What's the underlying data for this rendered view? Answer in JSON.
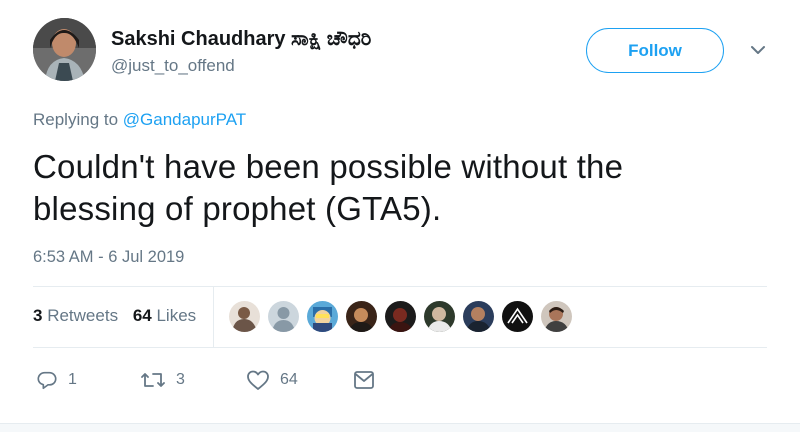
{
  "user": {
    "display_name": "Sakshi Chaudhary ಸಾಕ್ಷಿ ಚೌಧರಿ",
    "handle": "@just_to_offend"
  },
  "follow_label": "Follow",
  "reply": {
    "prefix": "Replying to ",
    "to": "@GandapurPAT"
  },
  "tweet": {
    "text": "Couldn't have been possible without the blessing of prophet (GTA5).",
    "timestamp": "6:53 AM - 6 Jul 2019"
  },
  "stats": {
    "retweets_count": "3",
    "retweets_label": "Retweets",
    "likes_count": "64",
    "likes_label": "Likes"
  },
  "actions": {
    "reply_count": "1",
    "retweet_count": "3",
    "like_count": "64"
  },
  "colors": {
    "accent": "#1da1f2",
    "muted": "#657786"
  },
  "icons": [
    "reply-icon",
    "retweet-icon",
    "heart-icon",
    "message-icon",
    "chevron-down-icon"
  ]
}
